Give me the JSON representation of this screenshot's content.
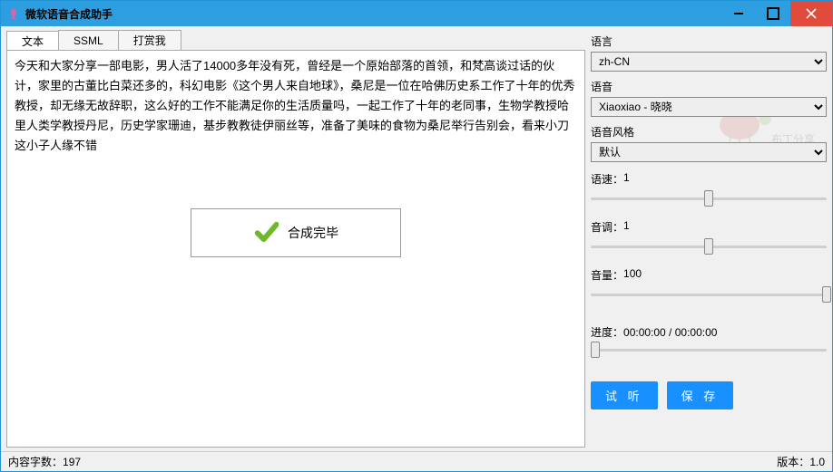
{
  "window": {
    "title": "微软语音合成助手"
  },
  "tabs": {
    "items": [
      {
        "label": "文本",
        "active": true
      },
      {
        "label": "SSML",
        "active": false
      },
      {
        "label": "打赏我",
        "active": false
      }
    ]
  },
  "text_content": "今天和大家分享一部电影，男人活了14000多年没有死，曾经是一个原始部落的首领，和梵高谈过话的伙计，家里的古董比白菜还多的，科幻电影《这个男人来自地球》，桑尼是一位在哈佛历史系工作了十年的优秀教授，却无缘无故辞职，这么好的工作不能满足你的生活质量吗，一起工作了十年的老同事，生物学教授哈里人类学教授丹尼，历史学家珊迪，基步教教徒伊丽丝等，准备了美味的食物为桑尼举行告别会，看来小刀这小子人缘不错",
  "toast": {
    "text": "合成完毕"
  },
  "panel": {
    "lang_label": "语言",
    "lang_value": "zh-CN",
    "voice_label": "语音",
    "voice_value": "Xiaoxiao - 晓晓",
    "style_label": "语音风格",
    "style_value": "默认",
    "speed": {
      "label": "语速：",
      "value": "1",
      "percent": 50
    },
    "pitch": {
      "label": "音调：",
      "value": "1",
      "percent": 50
    },
    "volume": {
      "label": "音量：",
      "value": "100",
      "percent": 100
    },
    "progress_label": "进度：",
    "progress_value": "00:00:00 / 00:00:00",
    "progress_percent": 0,
    "preview_btn": "试 听",
    "save_btn": "保 存"
  },
  "status": {
    "char_count_label": "内容字数：",
    "char_count_value": "197",
    "version_label": "版本：",
    "version_value": "1.0"
  }
}
